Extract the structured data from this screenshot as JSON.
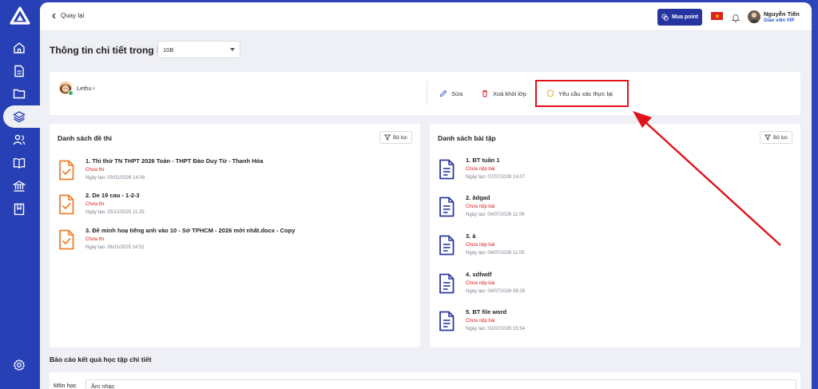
{
  "topbar": {
    "back_label": "Quay lại",
    "buy_point_label": "Mua point",
    "user_name": "Nguyễn Tiến",
    "user_role": "Giáo viên VIP"
  },
  "page": {
    "title": "Thông tin chi tiết trong lớp",
    "class_select_value": "10B"
  },
  "student": {
    "name": "Lethu",
    "gender_symbol": "♀"
  },
  "actions": {
    "edit_label": "Sửa",
    "remove_label": "Xoá khỏi lớp",
    "reverify_label": "Yêu cầu xác thực lại"
  },
  "exams": {
    "title": "Danh sách đề thi",
    "filter_label": "Bộ lọc",
    "items": [
      {
        "title": "1. Thi thử TN THPT 2026 Toán - THPT Đào Duy Từ - Thanh Hóa",
        "status": "Chưa thi",
        "date": "Ngày tạo: 03/02/2026 14:08"
      },
      {
        "title": "2. De 19 cau - 1-2-3",
        "status": "Chưa thi",
        "date": "Ngày tạo: 25/12/2025 11:25"
      },
      {
        "title": "3. Đề minh hoạ tiếng anh vào 10 - Sở TPHCM - 2026 mới nhất.docx - Copy",
        "status": "Chưa thi",
        "date": "Ngày tạo: 06/11/2025 14:52"
      }
    ]
  },
  "homework": {
    "title": "Danh sách bài tập",
    "filter_label": "Bộ lọc",
    "items": [
      {
        "title": "1. BT tuần 1",
        "status": "Chưa nộp bài",
        "date": "Ngày tạo: 07/07/2026 14:07"
      },
      {
        "title": "2. ădgad",
        "status": "Chưa nộp bài",
        "date": "Ngày tạo: 04/07/2026 11:06"
      },
      {
        "title": "3. à",
        "status": "Chưa nộp bài",
        "date": "Ngày tạo: 04/07/2026 11:05"
      },
      {
        "title": "4. sdfwdf",
        "status": "Chưa nộp bài",
        "date": "Ngày tạo: 04/07/2026 08:26"
      },
      {
        "title": "5. BT file word",
        "status": "Chưa nộp bài",
        "date": "Ngày tạo: 02/07/2026 15:54"
      }
    ]
  },
  "report": {
    "title": "Báo cáo kết quả học tập chi tiết",
    "subject_label": "Môn học",
    "subject_value": "Âm nhạc"
  },
  "colors": {
    "sidebar": "#2740b5",
    "exam_icon": "#f07f2e",
    "homework_icon": "#2a3a9e",
    "status_red": "#e0121a",
    "highlight": "#e0121a"
  },
  "icons": {
    "sidebar": [
      "home-icon",
      "document-icon",
      "folder-icon",
      "layers-icon",
      "users-icon",
      "book-icon",
      "bank-icon",
      "bookmark-icon",
      "settings-icon"
    ]
  }
}
